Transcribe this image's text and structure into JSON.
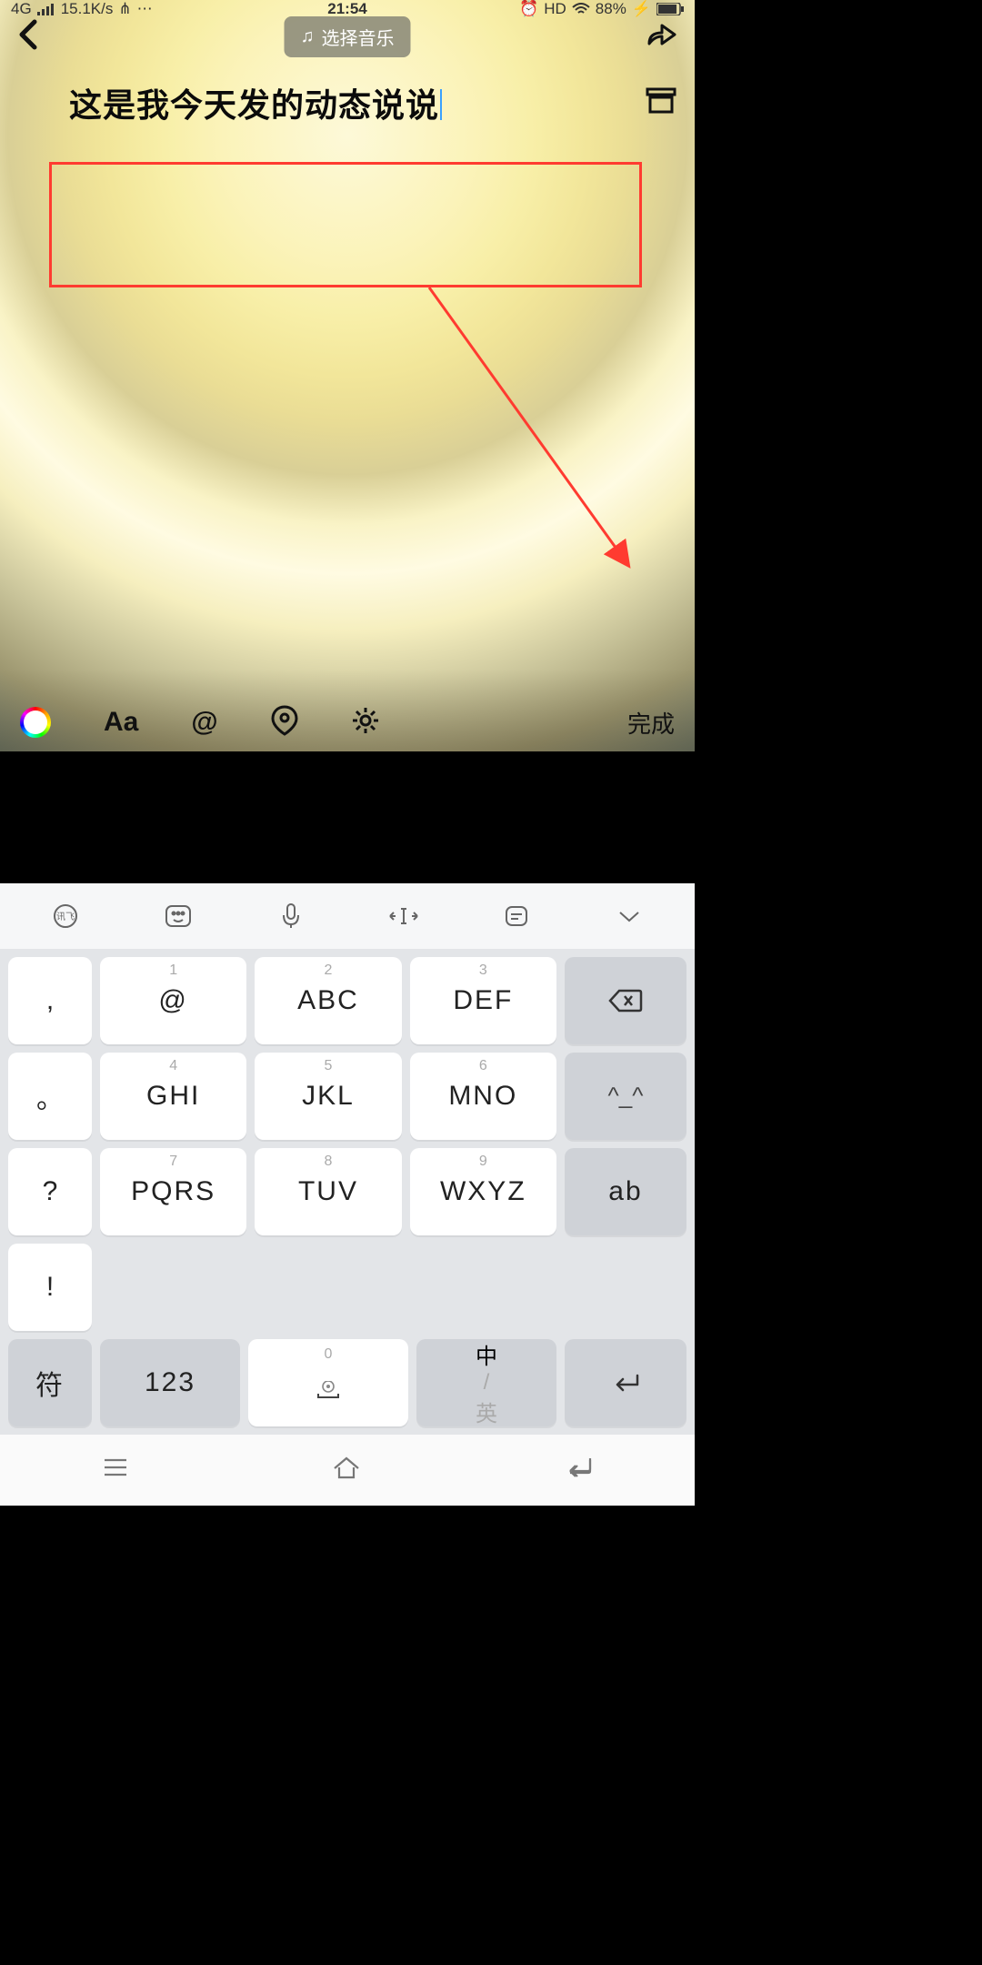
{
  "status": {
    "net": "4G",
    "speed": "15.1K/s",
    "time": "21:54",
    "hd": "HD",
    "battery": "88%"
  },
  "topbar": {
    "music_label": "选择音乐"
  },
  "editor": {
    "text": "这是我今天发的动态说说"
  },
  "toolbar": {
    "font": "Aa",
    "mention": "@",
    "done": "完成"
  },
  "kb_face": "^_^",
  "kb_ab": "ab",
  "kb_lang_cn": "中",
  "kb_lang_sep": "/",
  "kb_lang_en": "英",
  "kb_sym": "符",
  "kb_123": "123",
  "keys": {
    "r1c1": ",",
    "r2c1": "。",
    "r3c1": "?",
    "r4c1": "!",
    "k1n": "1",
    "k1m": "@",
    "k2n": "2",
    "k2m": "ABC",
    "k3n": "3",
    "k3m": "DEF",
    "k4n": "4",
    "k4m": "GHI",
    "k5n": "5",
    "k5m": "JKL",
    "k6n": "6",
    "k6m": "MNO",
    "k7n": "7",
    "k7m": "PQRS",
    "k8n": "8",
    "k8m": "TUV",
    "k9n": "9",
    "k9m": "WXYZ",
    "k0n": "0"
  }
}
